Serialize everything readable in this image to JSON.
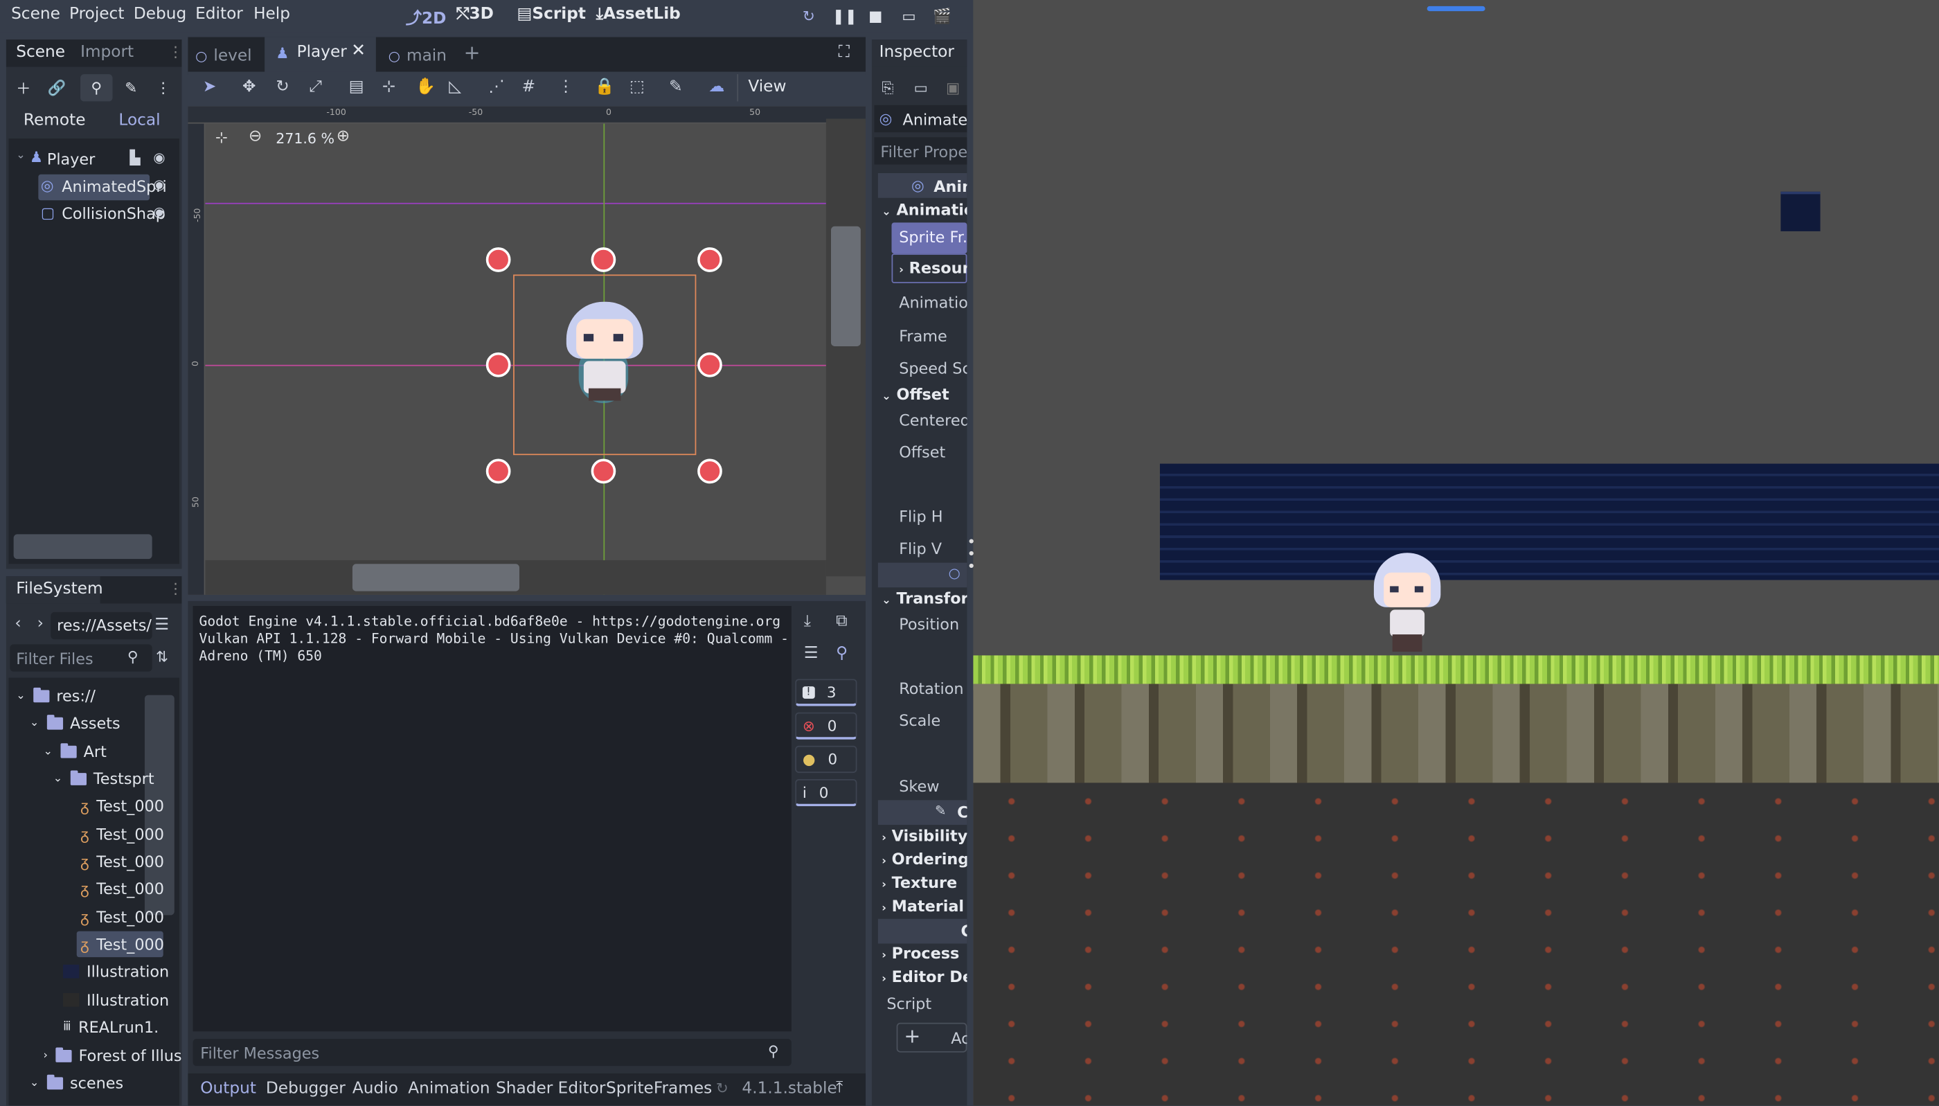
{
  "menubar": {
    "menus": [
      "Scene",
      "Project",
      "Debug",
      "Editor",
      "Help"
    ],
    "main_screens": [
      "2D",
      "3D",
      "Script",
      "AssetLib"
    ]
  },
  "scene_dock": {
    "tabs": [
      "Scene",
      "Import"
    ],
    "remote": "Remote",
    "local": "Local",
    "nodes": [
      "Player",
      "AnimatedSpri",
      "CollisionShap"
    ]
  },
  "filesystem": {
    "title": "FileSystem",
    "path": "res://Assets/",
    "filter_placeholder": "Filter Files",
    "items": [
      "res://",
      "Assets",
      "Art",
      "Testsprt",
      "Test_000",
      "Test_000",
      "Test_000",
      "Test_000",
      "Test_000",
      "Test_000",
      "Illustration",
      "Illustration",
      "REALrun1.",
      "Forest of Illus",
      "scenes"
    ]
  },
  "editor_tabs": [
    "level",
    "Player",
    "main"
  ],
  "toolbar": {
    "view": "View"
  },
  "viewport": {
    "zoom": "271.6 %",
    "ruler_labels": [
      "-100",
      "-50",
      "0",
      "50"
    ],
    "vruler_labels": [
      "-50",
      "0",
      "50"
    ]
  },
  "output": {
    "lines": [
      "Godot Engine v4.1.1.stable.official.bd6af8e0e - https://godotengine.org",
      "Vulkan API 1.1.128 - Forward Mobile - Using Vulkan Device #0: Qualcomm -",
      "Adreno (TM) 650"
    ],
    "filter_placeholder": "Filter Messages",
    "counters": [
      "3",
      "0",
      "0",
      "0"
    ]
  },
  "bottom_tabs": [
    "Output",
    "Debugger",
    "Audio",
    "Animation",
    "Shader Editor",
    "SpriteFrames"
  ],
  "version": "4.1.1.stable",
  "inspector": {
    "title": "Inspector",
    "node": "Animatec",
    "filter_placeholder": "Filter Proper",
    "class": "Anin",
    "sections": {
      "animation": "Animation",
      "sprite_frames": "Sprite Fr..",
      "resource": "Resourc",
      "animation_row": "Animation",
      "frame": "Frame",
      "speed": "Speed Sca",
      "offset_sec": "Offset",
      "centered": "Centered",
      "offset": "Offset",
      "fliph": "Flip H",
      "flipv": "Flip V",
      "transform": "Transform",
      "position": "Position",
      "rotation": "Rotation",
      "scale": "Scale",
      "skew": "Skew",
      "visibility": "Visibility",
      "ordering": "Ordering",
      "texture": "Texture",
      "material": "Material",
      "process": "Process",
      "editor_desc": "Editor Des",
      "script": "Script",
      "add": "Ac",
      "c_label": "C",
      "c2_label": "C"
    }
  },
  "colors": {
    "accent": "#a5b0e8",
    "handle": "#e85058",
    "selection_box": "#e0895a",
    "grass": "#8bc34a"
  }
}
